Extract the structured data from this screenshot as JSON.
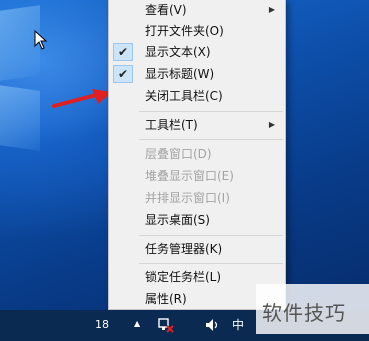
{
  "context_menu": {
    "items": [
      {
        "label": "查看(V)",
        "checked": false,
        "submenu": true,
        "disabled": false
      },
      {
        "label": "打开文件夹(O)",
        "checked": false,
        "submenu": false,
        "disabled": false
      },
      {
        "label": "显示文本(X)",
        "checked": true,
        "submenu": false,
        "disabled": false
      },
      {
        "label": "显示标题(W)",
        "checked": true,
        "submenu": false,
        "disabled": false
      },
      {
        "label": "关闭工具栏(C)",
        "checked": false,
        "submenu": false,
        "disabled": false
      },
      {
        "label": "工具栏(T)",
        "checked": false,
        "submenu": true,
        "disabled": false
      },
      {
        "label": "层叠窗口(D)",
        "checked": false,
        "submenu": false,
        "disabled": true
      },
      {
        "label": "堆叠显示窗口(E)",
        "checked": false,
        "submenu": false,
        "disabled": true
      },
      {
        "label": "并排显示窗口(I)",
        "checked": false,
        "submenu": false,
        "disabled": true
      },
      {
        "label": "显示桌面(S)",
        "checked": false,
        "submenu": false,
        "disabled": false
      },
      {
        "label": "任务管理器(K)",
        "checked": false,
        "submenu": false,
        "disabled": false
      },
      {
        "label": "锁定任务栏(L)",
        "checked": false,
        "submenu": false,
        "disabled": false
      },
      {
        "label": "属性(R)",
        "checked": false,
        "submenu": false,
        "disabled": false
      }
    ],
    "check_glyph": "✔",
    "submenu_glyph": "▶"
  },
  "taskbar": {
    "number": "18",
    "tray_up_glyph": "▲",
    "network_icon": "network-error-icon",
    "volume_icon": "volume-icon",
    "ime_label": "中"
  },
  "watermark": {
    "text": "软件技巧"
  },
  "annotation": {
    "arrow_color": "#e02020"
  },
  "colors": {
    "menu_bg": "#f0f0f0",
    "check_bg": "#cce4f7",
    "disabled_text": "#a3a3a3",
    "taskbar": "#0b2a52"
  }
}
